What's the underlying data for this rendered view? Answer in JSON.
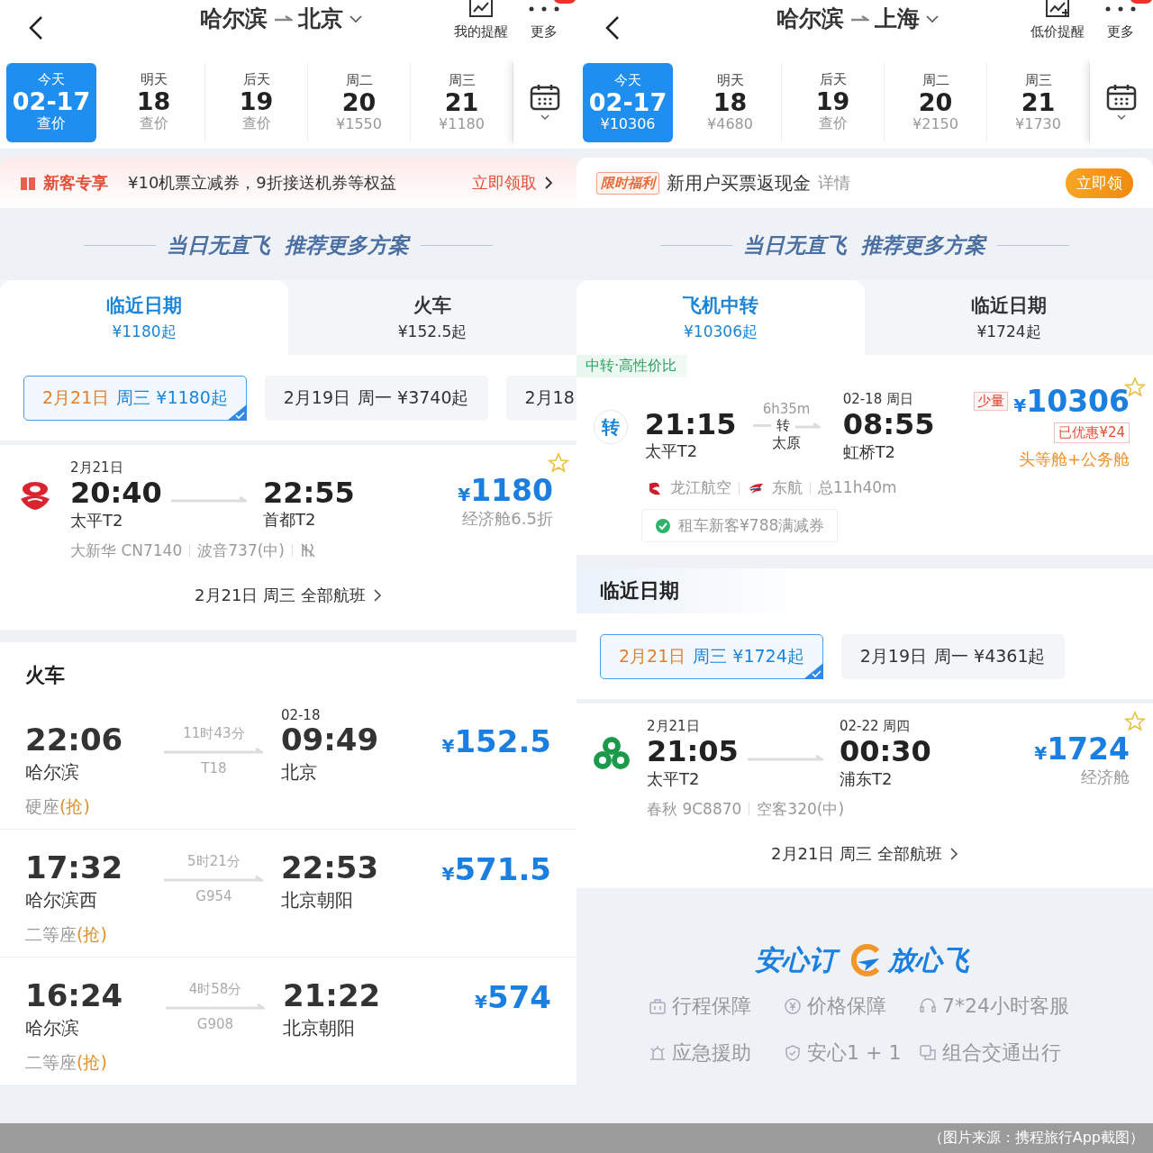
{
  "screens": [
    {
      "header": {
        "from": "哈尔滨",
        "to": "北京",
        "actions": [
          {
            "kind": "alert",
            "label": "我的提醒"
          },
          {
            "kind": "more",
            "label": "更多"
          }
        ]
      },
      "dates": [
        {
          "day": "今天",
          "date": "02-17",
          "price": "查价",
          "selected": true
        },
        {
          "day": "明天",
          "date": "18",
          "price": "查价",
          "selected": false
        },
        {
          "day": "后天",
          "date": "19",
          "price": "查价",
          "selected": false
        },
        {
          "day": "周二",
          "date": "20",
          "price": "¥1550",
          "selected": false
        },
        {
          "day": "周三",
          "date": "21",
          "price": "¥1180",
          "selected": false
        }
      ],
      "sections": [
        {
          "kind": "promo_red",
          "tag": "新客专享",
          "text": "¥10机票立减券，9折接送机券等权益",
          "action": "立即领取"
        },
        {
          "kind": "banner",
          "title": "当日无直飞  推荐更多方案"
        },
        {
          "kind": "tabs",
          "tabs": [
            {
              "label": "临近日期",
              "price": "¥1180起",
              "selected": true
            },
            {
              "label": "火车",
              "price": "¥152.5起",
              "selected": false
            }
          ]
        },
        {
          "kind": "chips",
          "chips": [
            {
              "date": "2月21日",
              "detail": "周三 ¥1180起",
              "selected": true
            },
            {
              "date": "2月19日",
              "detail": "周一 ¥3740起",
              "selected": false
            },
            {
              "date": "2月18",
              "selected": false
            }
          ]
        },
        {
          "kind": "flight",
          "dep_date": "2月21日",
          "dep_time": "20:40",
          "dep_airport": "太平T2",
          "arr_time": "22:55",
          "arr_airport": "首都T2",
          "currency": "¥",
          "amount": "1180",
          "cabin": "经济舱6.5折",
          "info": [
            "大新华 CN7140",
            "波音737(中)"
          ],
          "meal": true
        },
        {
          "kind": "all_flights",
          "label": "2月21日 周三 全部航班"
        },
        {
          "kind": "trains",
          "title": "火车",
          "rows": [
            {
              "dep_time": "22:06",
              "dep_station": "哈尔滨",
              "duration": "11时43分",
              "number": "T18",
              "arr_date": "02-18",
              "arr_time": "09:49",
              "arr_station": "北京",
              "currency": "¥",
              "amount": "152.5",
              "seat": "硬座",
              "seat_note": "(抢)"
            },
            {
              "dep_time": "17:32",
              "dep_station": "哈尔滨西",
              "duration": "5时21分",
              "number": "G954",
              "arr_time": "22:53",
              "arr_station": "北京朝阳",
              "currency": "¥",
              "amount": "571.5",
              "seat": "二等座",
              "seat_note": "(抢)"
            },
            {
              "dep_time": "16:24",
              "dep_station": "哈尔滨",
              "duration": "4时58分",
              "number": "G908",
              "arr_time": "21:22",
              "arr_station": "北京朝阳",
              "currency": "¥",
              "amount": "574",
              "seat": "二等座",
              "seat_note": "(抢)"
            }
          ]
        }
      ]
    },
    {
      "header": {
        "from": "哈尔滨",
        "to": "上海",
        "actions": [
          {
            "kind": "alert_plus",
            "label": "低价提醒"
          },
          {
            "kind": "more",
            "label": "更多"
          }
        ]
      },
      "dates": [
        {
          "day": "今天",
          "date": "02-17",
          "price": "¥10306",
          "selected": true
        },
        {
          "day": "明天",
          "date": "18",
          "price": "¥4680",
          "selected": false
        },
        {
          "day": "后天",
          "date": "19",
          "price": "查价",
          "selected": false
        },
        {
          "day": "周二",
          "date": "20",
          "price": "¥2150",
          "selected": false
        },
        {
          "day": "周三",
          "date": "21",
          "price": "¥1730",
          "selected": false
        }
      ],
      "sections": [
        {
          "kind": "promo_gold",
          "tag": "限时福利",
          "text": "新用户买票返现金",
          "link": "详情",
          "action": "立即领"
        },
        {
          "kind": "banner",
          "title": "当日无直飞  推荐更多方案"
        },
        {
          "kind": "tabs",
          "tabs": [
            {
              "label": "飞机中转",
              "price": "¥10306起",
              "selected": true
            },
            {
              "label": "临近日期",
              "price": "¥1724起",
              "selected": false
            }
          ]
        },
        {
          "kind": "transfer",
          "badge": "中转·高性价比",
          "logo_char": "转",
          "dep_time": "21:15",
          "dep_airport": "太平T2",
          "duration": "6h35m",
          "via_mark": "转",
          "via_city": "太原",
          "arr_date": "02-18 周日",
          "arr_time": "08:55",
          "arr_airport": "虹桥T2",
          "stock": "少量",
          "currency": "¥",
          "amount": "10306",
          "discount": "已优惠¥24",
          "cabin": "头等舱+公务舱",
          "airlines": [
            {
              "name": "龙江航空"
            },
            {
              "name": "东航"
            }
          ],
          "total": "总11h40m",
          "coupon": "租车新客¥788满减券"
        },
        {
          "kind": "heading",
          "title": "临近日期"
        },
        {
          "kind": "chips",
          "chips": [
            {
              "date": "2月21日",
              "detail": "周三 ¥1724起",
              "selected": true
            },
            {
              "date": "2月19日",
              "detail": "周一 ¥4361起",
              "selected": false
            }
          ]
        },
        {
          "kind": "flight",
          "dep_date": "2月21日",
          "dep_time": "21:05",
          "dep_airport": "太平T2",
          "arr_date": "02-22 周四",
          "arr_time": "00:30",
          "arr_airport": "浦东T2",
          "currency": "¥",
          "amount": "1724",
          "cabin": "经济舱",
          "info": [
            "春秋 9C8870",
            "空客320(中)"
          ],
          "meal": false
        },
        {
          "kind": "all_flights",
          "label": "2月21日 周三 全部航班"
        },
        {
          "kind": "guarantee",
          "title_left": "安心订",
          "title_right": "放心飞",
          "items": [
            {
              "label": "行程保障"
            },
            {
              "label": "价格保障"
            },
            {
              "label": "7*24小时客服"
            },
            {
              "label": "应急援助"
            },
            {
              "label": "安心1 + 1"
            },
            {
              "label": "组合交通出行"
            }
          ]
        }
      ]
    }
  ],
  "caption": "（图片来源：携程旅行App截图）"
}
